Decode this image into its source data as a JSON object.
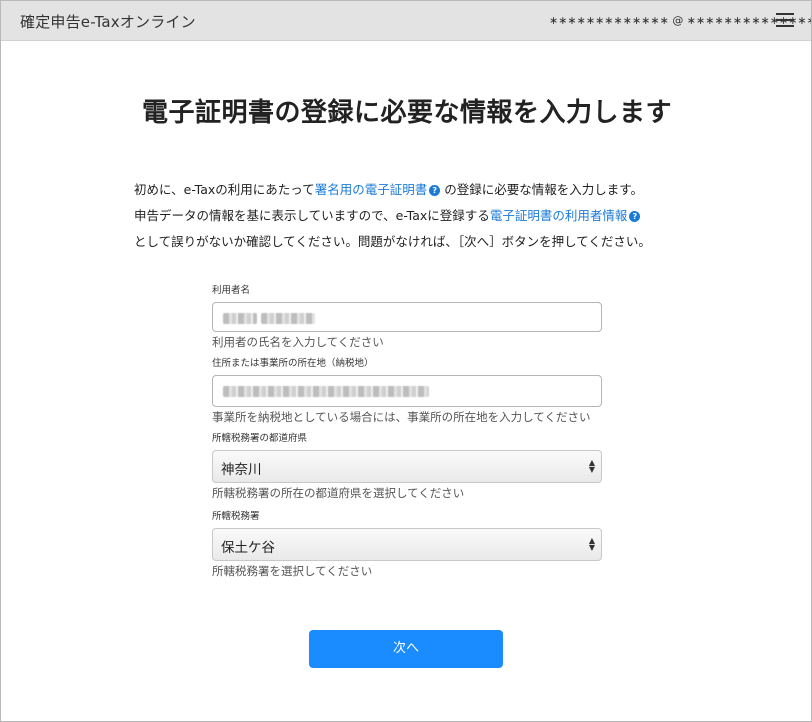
{
  "header": {
    "app_title": "確定申告e-Taxオンライン",
    "user_info": "∗∗∗∗∗∗∗∗∗∗∗∗∗ @ ∗∗∗∗∗∗∗∗∗∗∗∗∗∗∗"
  },
  "page": {
    "title": "電子証明書の登録に必要な情報を入力します"
  },
  "intro": {
    "line1_a": "初めに、e-Taxの利用にあたって",
    "line1_link": "署名用の電子証明書",
    "line1_b": "の登録に必要な情報を入力します。",
    "line2_a": "申告データの情報を基に表示していますので、e-Taxに登録する",
    "line2_link": "電子証明書の利用者情報",
    "line3": "として誤りがないか確認してください。問題がなければ、［次へ］ボタンを押してください。",
    "help_glyph": "?"
  },
  "form": {
    "name": {
      "label": "利用者名",
      "hint": "利用者の氏名を入力してください"
    },
    "address": {
      "label": "住所または事業所の所在地（納税地）",
      "hint": "事業所を納税地としている場合には、事業所の所在地を入力してください"
    },
    "prefecture": {
      "label": "所轄税務署の都道府県",
      "value": "神奈川",
      "hint": "所轄税務署の所在の都道府県を選択してください"
    },
    "tax_office": {
      "label": "所轄税務署",
      "value": "保土ケ谷",
      "hint": "所轄税務署を選択してください"
    }
  },
  "actions": {
    "next_label": "次へ"
  },
  "colors": {
    "accent": "#1a8cff",
    "link": "#1a7ad8",
    "header_bg": "#e3e3e3"
  }
}
